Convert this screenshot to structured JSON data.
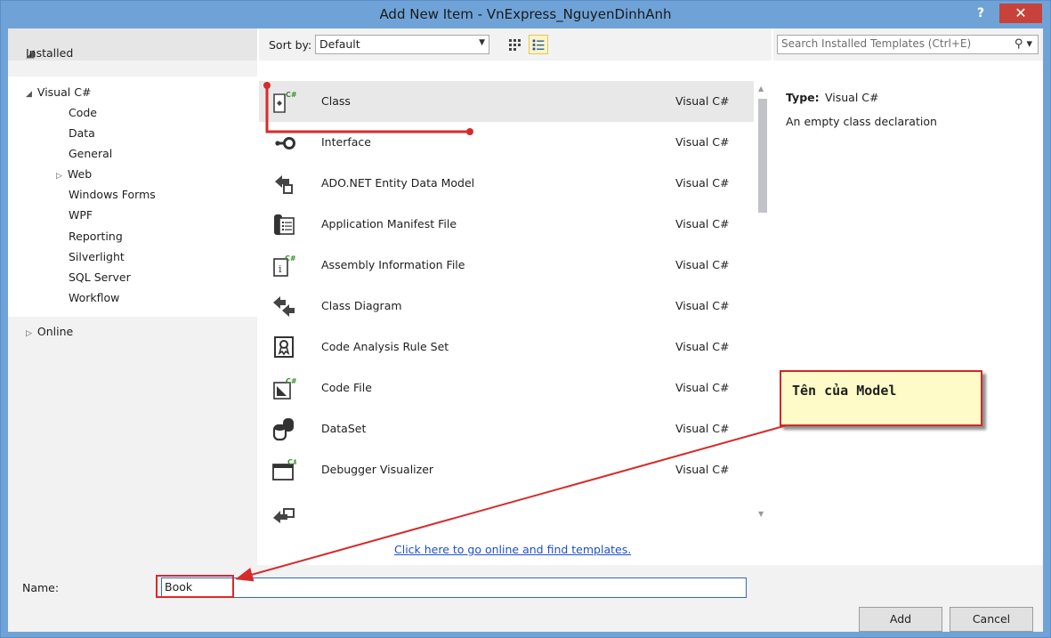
{
  "window": {
    "title": "Add New Item - VnExpress_NguyenDinhAnh",
    "help_label": "?",
    "close_label": "✕"
  },
  "tree": {
    "installed_label": "Installed",
    "items": [
      {
        "label": "Visual C#"
      },
      {
        "label": "Code"
      },
      {
        "label": "Data"
      },
      {
        "label": "General"
      },
      {
        "label": "Web"
      },
      {
        "label": "Windows Forms"
      },
      {
        "label": "WPF"
      },
      {
        "label": "Reporting"
      },
      {
        "label": "Silverlight"
      },
      {
        "label": "SQL Server"
      },
      {
        "label": "Workflow"
      }
    ],
    "online_label": "Online"
  },
  "toolbar": {
    "sort_label": "Sort by:",
    "sort_value": "Default"
  },
  "templates": [
    {
      "name": "Class",
      "lang": "Visual C#",
      "icon": "class-icon",
      "selected": true
    },
    {
      "name": "Interface",
      "lang": "Visual C#",
      "icon": "interface-icon"
    },
    {
      "name": "ADO.NET Entity Data Model",
      "lang": "Visual C#",
      "icon": "entity-data-model-icon"
    },
    {
      "name": "Application Manifest File",
      "lang": "Visual C#",
      "icon": "manifest-file-icon"
    },
    {
      "name": "Assembly Information File",
      "lang": "Visual C#",
      "icon": "assembly-info-icon"
    },
    {
      "name": "Class Diagram",
      "lang": "Visual C#",
      "icon": "class-diagram-icon"
    },
    {
      "name": "Code Analysis Rule Set",
      "lang": "Visual C#",
      "icon": "rule-set-icon"
    },
    {
      "name": "Code File",
      "lang": "Visual C#",
      "icon": "code-file-icon"
    },
    {
      "name": "DataSet",
      "lang": "Visual C#",
      "icon": "dataset-icon"
    },
    {
      "name": "Debugger Visualizer",
      "lang": "Visual C#",
      "icon": "debugger-visualizer-icon"
    }
  ],
  "online_link": "Click here to go online and find templates.",
  "search": {
    "placeholder": "Search Installed Templates (Ctrl+E)"
  },
  "details": {
    "type_label": "Type:",
    "type_value": "Visual C#",
    "description": "An empty class declaration"
  },
  "bottom": {
    "name_label": "Name:",
    "name_value": "Book",
    "add_label": "Add",
    "cancel_label": "Cancel"
  },
  "annotation": {
    "callout_text": "Tên của Model"
  },
  "colors": {
    "titlebar": "#6fa3d8",
    "close": "#c7423b",
    "annotation_red": "#d62b2b",
    "callout_bg": "#fffbc8",
    "link": "#1e50c7"
  }
}
